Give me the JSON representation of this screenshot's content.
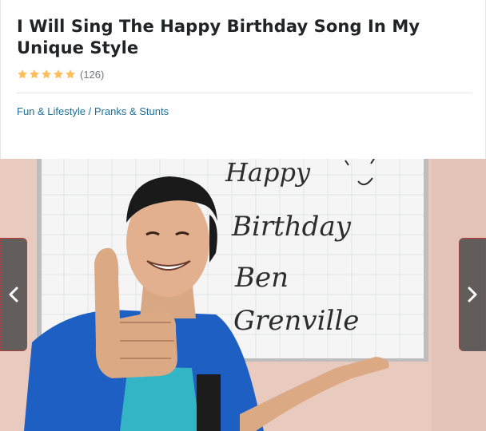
{
  "gig": {
    "title": "I Will Sing The Happy Birthday Song In My Unique Style",
    "rating": {
      "stars": 5,
      "count": "(126)",
      "star_color": "#ffbe5b"
    },
    "breadcrumb": {
      "category": "Fun & Lifestyle",
      "separator": "/",
      "subcategory": "Pranks & Stunts"
    },
    "colors": {
      "title": "#222325",
      "link": "#1e6f98",
      "muted": "#74767e"
    }
  },
  "media": {
    "whiteboard_lines": [
      "Happy",
      "Birthday",
      "Ben",
      "Grenville"
    ],
    "prev_icon": "chevron-left-icon",
    "next_icon": "chevron-right-icon"
  }
}
